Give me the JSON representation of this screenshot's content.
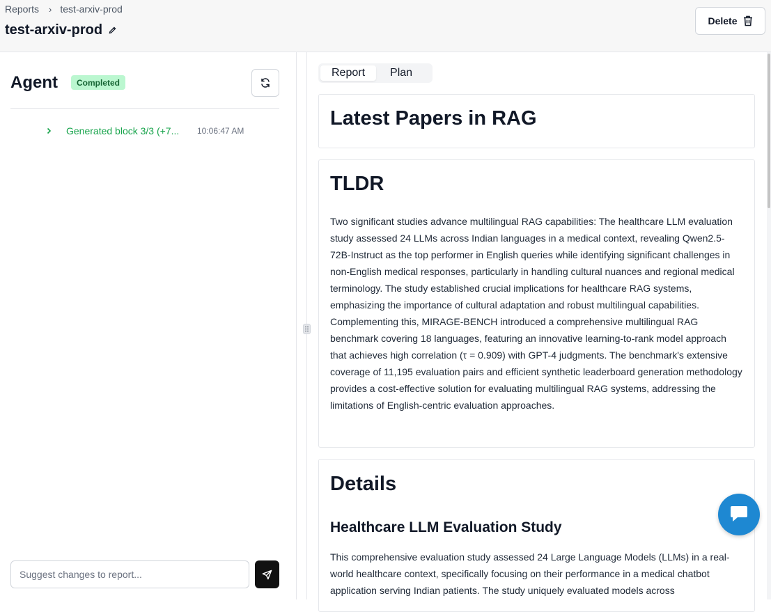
{
  "breadcrumb": {
    "root": "Reports",
    "current": "test-arxiv-prod"
  },
  "header": {
    "title": "test-arxiv-prod",
    "delete_label": "Delete"
  },
  "agent": {
    "title": "Agent",
    "status": "Completed",
    "logs": [
      {
        "text": "Generated block 3/3 (+7...",
        "time": "10:06:47 AM"
      }
    ],
    "input_placeholder": "Suggest changes to report..."
  },
  "tabs": [
    {
      "label": "Report",
      "active": true
    },
    {
      "label": "Plan",
      "active": false
    }
  ],
  "report": {
    "title": "Latest Papers in RAG",
    "tldr_heading": "TLDR",
    "tldr_body": "Two significant studies advance multilingual RAG capabilities: The healthcare LLM evaluation study assessed 24 LLMs across Indian languages in a medical context, revealing Qwen2.5-72B-Instruct as the top performer in English queries while identifying significant challenges in non-English medical responses, particularly in handling cultural nuances and regional medical terminology. The study established crucial implications for healthcare RAG systems, emphasizing the importance of cultural adaptation and robust multilingual capabilities. Complementing this, MIRAGE-BENCH introduced a comprehensive multilingual RAG benchmark covering 18 languages, featuring an innovative learning-to-rank model approach that achieves high correlation (τ = 0.909) with GPT-4 judgments. The benchmark's extensive coverage of 11,195 evaluation pairs and efficient synthetic leaderboard generation methodology provides a cost-effective solution for evaluating multilingual RAG systems, addressing the limitations of English-centric evaluation approaches.",
    "details_heading": "Details",
    "section_heading": "Healthcare LLM Evaluation Study",
    "section_body": "This comprehensive evaluation study assessed 24 Large Language Models (LLMs) in a real-world healthcare context, specifically focusing on their performance in a medical chatbot application serving Indian patients. The study uniquely evaluated models across"
  },
  "colors": {
    "accent_green": "#16a34a",
    "badge_bg": "#bbf7d0",
    "chat_blue": "#1e88d2"
  },
  "icons": [
    "pencil-icon",
    "trash-icon",
    "refresh-icon",
    "chevron-right-icon",
    "send-icon",
    "drag-handle-icon",
    "chat-icon"
  ]
}
